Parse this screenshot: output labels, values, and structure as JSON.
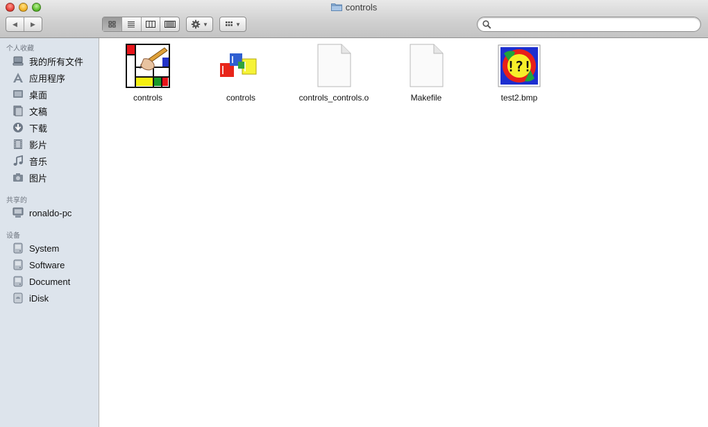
{
  "window": {
    "title": "controls"
  },
  "sidebar": {
    "sections": [
      {
        "header": "个人收藏",
        "items": [
          {
            "label": "我的所有文件",
            "icon": "all-files-icon"
          },
          {
            "label": "应用程序",
            "icon": "applications-icon"
          },
          {
            "label": "桌面",
            "icon": "desktop-icon"
          },
          {
            "label": "文稿",
            "icon": "documents-icon"
          },
          {
            "label": "下载",
            "icon": "downloads-icon"
          },
          {
            "label": "影片",
            "icon": "movies-icon"
          },
          {
            "label": "音乐",
            "icon": "music-icon"
          },
          {
            "label": "图片",
            "icon": "pictures-icon"
          }
        ]
      },
      {
        "header": "共享的",
        "items": [
          {
            "label": "ronaldo-pc",
            "icon": "computer-icon"
          }
        ]
      },
      {
        "header": "设备",
        "items": [
          {
            "label": "System",
            "icon": "disk-icon"
          },
          {
            "label": "Software",
            "icon": "disk-icon"
          },
          {
            "label": "Document",
            "icon": "disk-icon"
          },
          {
            "label": "iDisk",
            "icon": "idisk-icon"
          }
        ]
      }
    ]
  },
  "files": [
    {
      "name": "controls",
      "icon": "app-painting-icon"
    },
    {
      "name": "controls",
      "icon": "blocks-icon"
    },
    {
      "name": "controls_controls.o",
      "icon": "blank-document-icon"
    },
    {
      "name": "Makefile",
      "icon": "blank-document-icon"
    },
    {
      "name": "test2.bmp",
      "icon": "bmp-image-icon"
    }
  ],
  "colors": {
    "sidebar_bg": "#dde4ec",
    "section_header": "#6f7680"
  }
}
